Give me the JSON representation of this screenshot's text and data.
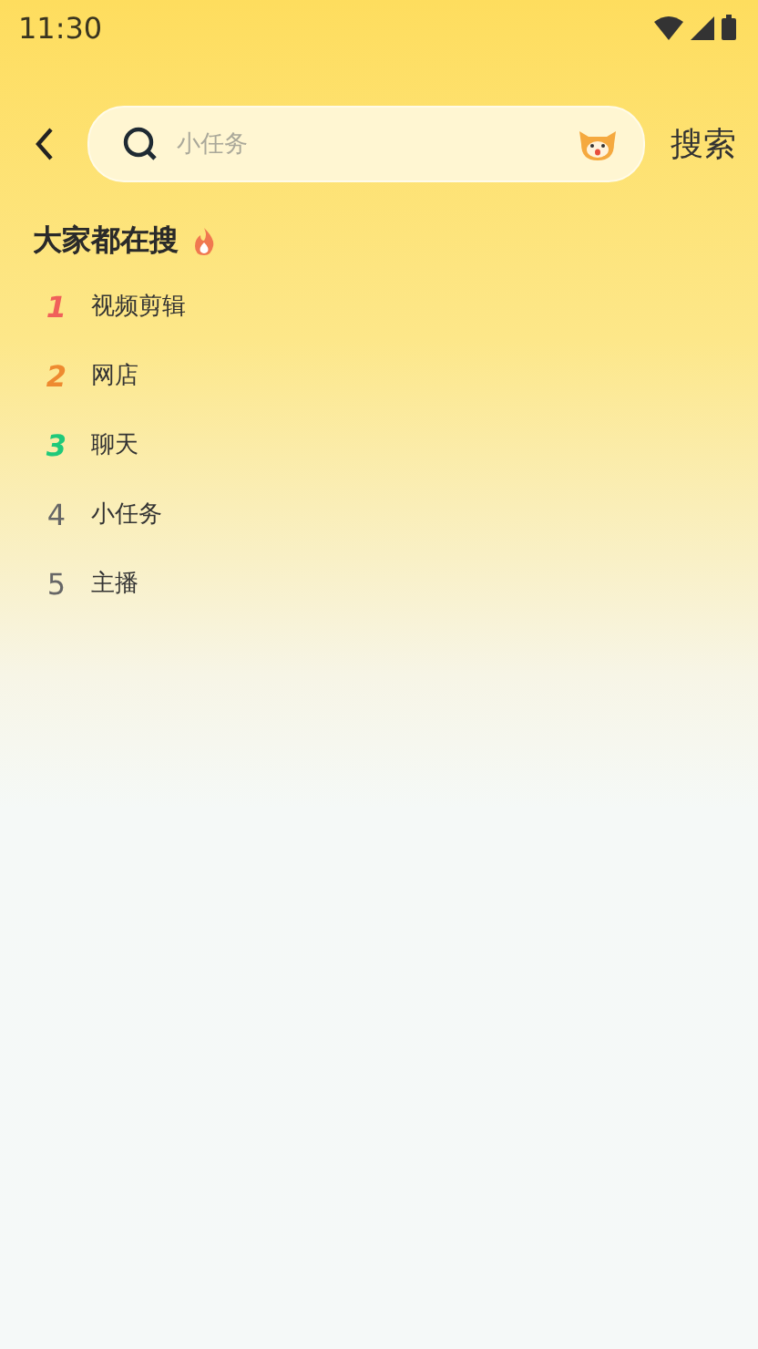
{
  "status_bar": {
    "time": "11:30"
  },
  "search": {
    "placeholder": "小任务",
    "button": "搜索"
  },
  "trending": {
    "title": "大家都在搜",
    "items": [
      {
        "rank": "1",
        "label": "视频剪辑",
        "kind": "top",
        "color": "#f0605a"
      },
      {
        "rank": "2",
        "label": "网店",
        "kind": "top",
        "color": "#ee8a30"
      },
      {
        "rank": "3",
        "label": "聊天",
        "kind": "top",
        "color": "#1fc97a"
      },
      {
        "rank": "4",
        "label": "小任务",
        "kind": "plain"
      },
      {
        "rank": "5",
        "label": "主播",
        "kind": "plain"
      }
    ]
  }
}
